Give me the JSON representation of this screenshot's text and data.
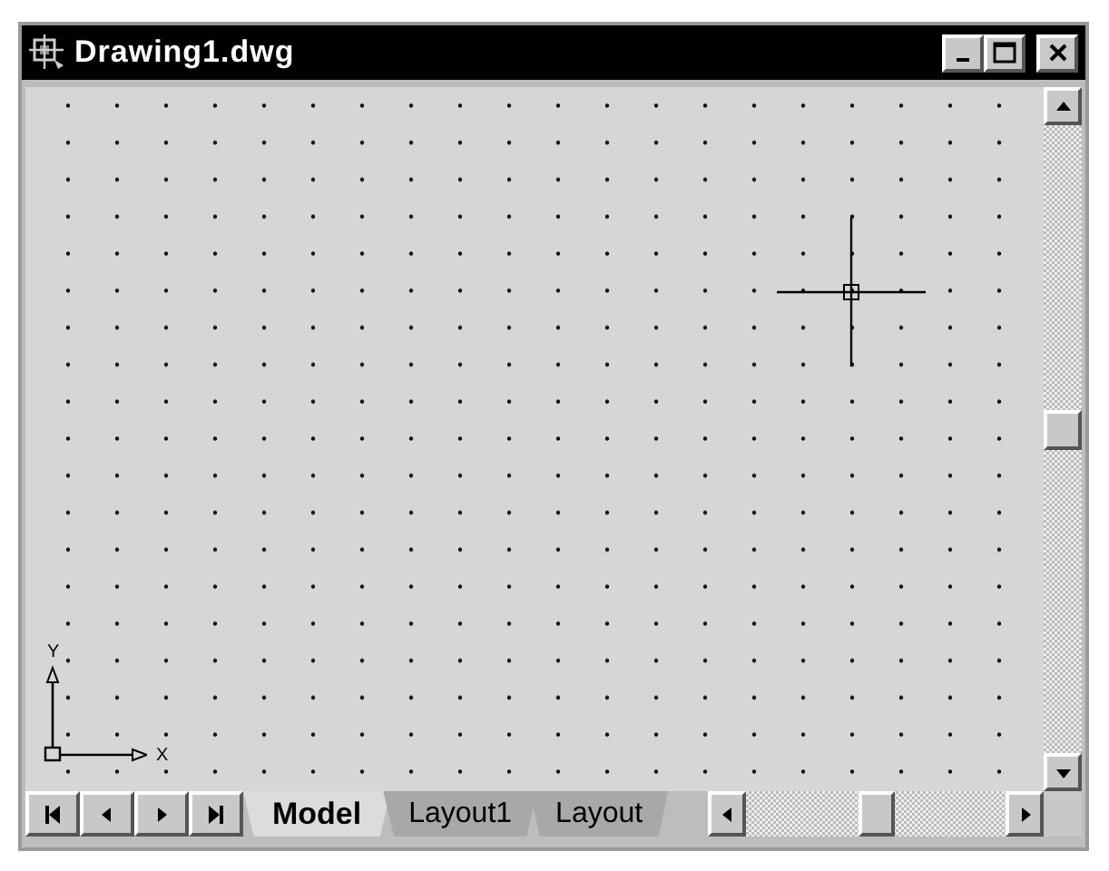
{
  "window": {
    "title": "Drawing1.dwg"
  },
  "ucs": {
    "y_label": "Y",
    "x_label": "X"
  },
  "tabs": [
    {
      "label": "Model",
      "selected": true
    },
    {
      "label": "Layout1",
      "selected": false
    },
    {
      "label": "Layout",
      "selected": false
    }
  ]
}
